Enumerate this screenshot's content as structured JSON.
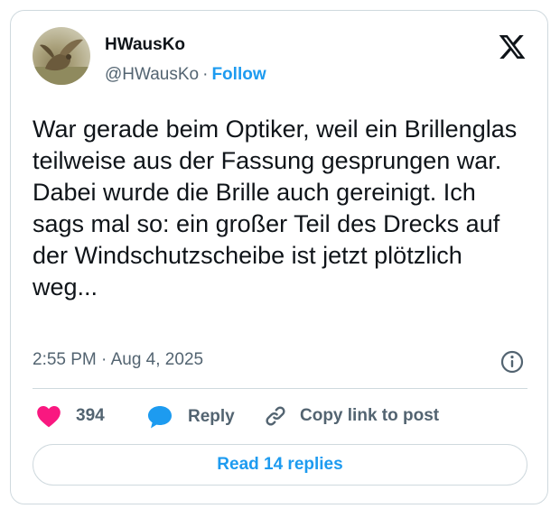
{
  "author": {
    "name": "HWausKo",
    "handle": "@HWausKo",
    "separator": "·",
    "follow_label": "Follow"
  },
  "tweet": {
    "text": "War gerade beim Optiker, weil ein Brillenglas teilweise aus der Fassung gesprungen war. Dabei wurde die Brille auch gereinigt. Ich sags mal so: ein großer Teil des Drecks auf der Windschutzscheibe ist jetzt plötzlich weg...",
    "timestamp": "2:55 PM · Aug 4, 2025"
  },
  "actions": {
    "like_count": "394",
    "reply_label": "Reply",
    "copy_link_label": "Copy link to post"
  },
  "read_replies_label": "Read 14 replies",
  "icons": {
    "logo": "x-logo-icon",
    "info": "info-icon",
    "like": "heart-icon",
    "reply": "speech-bubble-icon",
    "copy_link": "link-icon"
  },
  "colors": {
    "accent": "#1d9bf0",
    "heart": "#f91880",
    "text_primary": "#0f1419",
    "text_secondary": "#536471",
    "border": "#cfd9de"
  }
}
